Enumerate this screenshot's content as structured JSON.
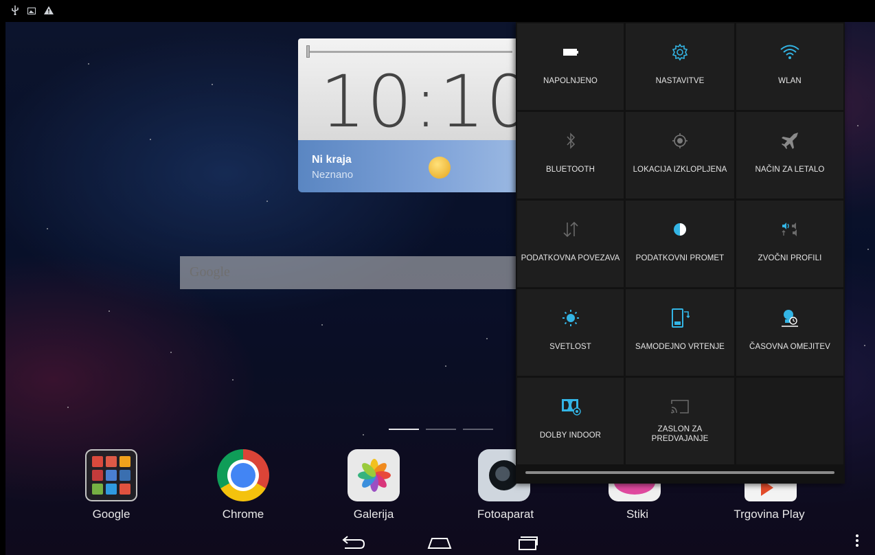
{
  "status_bar": {
    "icons": [
      "usb-icon",
      "image-icon",
      "warning-icon"
    ]
  },
  "clock_widget": {
    "time": "10:10",
    "weather_title": "Ni kraja",
    "weather_subtitle": "Neznano"
  },
  "search_bar": {
    "label": "Google"
  },
  "dock": {
    "apps": [
      {
        "label": "Google",
        "icon": "google-folder-icon"
      },
      {
        "label": "Chrome",
        "icon": "chrome-icon"
      },
      {
        "label": "Galerija",
        "icon": "gallery-icon"
      },
      {
        "label": "Fotoaparat",
        "icon": "camera-icon"
      },
      {
        "label": "Stiki",
        "icon": "contacts-icon"
      },
      {
        "label": "Trgovina Play",
        "icon": "play-store-icon"
      }
    ]
  },
  "quick_settings": {
    "tiles": [
      {
        "label": "NAPOLNJENO",
        "icon": "battery-icon"
      },
      {
        "label": "NASTAVITVE",
        "icon": "settings-gear-icon"
      },
      {
        "label": "WLAN",
        "icon": "wifi-icon"
      },
      {
        "label": "BLUETOOTH",
        "icon": "bluetooth-icon"
      },
      {
        "label": "LOKACIJA IZKLOPLJENA",
        "icon": "location-icon"
      },
      {
        "label": "NAČIN ZA LETALO",
        "icon": "airplane-icon"
      },
      {
        "label": "PODATKOVNA POVEZAVA",
        "icon": "data-arrows-icon"
      },
      {
        "label": "PODATKOVNI PROMET",
        "icon": "data-usage-icon"
      },
      {
        "label": "ZVOČNI PROFILI",
        "icon": "sound-profile-icon"
      },
      {
        "label": "SVETLOST",
        "icon": "brightness-icon"
      },
      {
        "label": "SAMODEJNO VRTENJE",
        "icon": "auto-rotate-icon"
      },
      {
        "label": "ČASOVNA OMEJITEV",
        "icon": "timeout-icon"
      },
      {
        "label": "DOLBY INDOOR",
        "icon": "dolby-icon"
      },
      {
        "label": "ZASLON ZA PREDVAJANJE",
        "icon": "cast-screen-icon"
      }
    ],
    "accent_color": "#33b5e5"
  },
  "nav_bar": {
    "buttons": [
      "back-icon",
      "home-icon",
      "recents-icon"
    ]
  }
}
